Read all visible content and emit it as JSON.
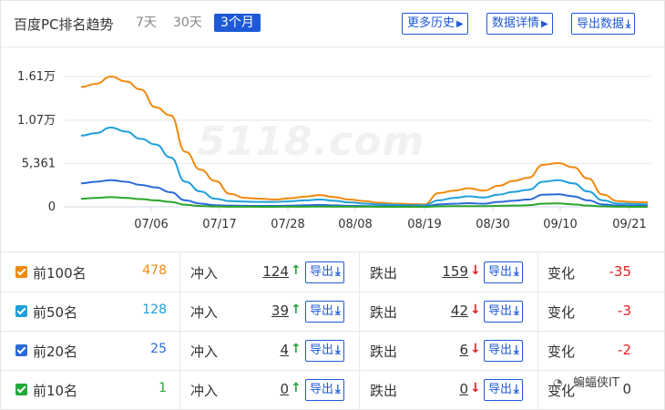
{
  "header": {
    "title": "百度PC排名趋势",
    "ranges": [
      "7天",
      "30天",
      "3个月"
    ],
    "active_range": "3个月",
    "buttons": {
      "more_history": "更多历史",
      "data_detail": "数据详情",
      "export_data": "导出数据"
    },
    "icons": {
      "more_history": "caret-right-icon",
      "data_detail": "caret-right-icon",
      "export_data": "download-icon"
    }
  },
  "watermark": "5118.com",
  "chart_data": {
    "type": "line",
    "x": [
      "07/06",
      "07/17",
      "07/28",
      "08/08",
      "08/19",
      "08/30",
      "09/10",
      "09/21"
    ],
    "y_ticks": [
      "0",
      "5,361",
      "1.07万",
      "1.61万"
    ],
    "ylim": [
      0,
      16100
    ],
    "grid": true,
    "series": [
      {
        "name": "前100名",
        "color": "#f0890c",
        "values": [
          14800,
          15200,
          16100,
          15500,
          14500,
          12300,
          11300,
          6800,
          4600,
          3200,
          1600,
          1100,
          1000,
          900,
          1050,
          1250,
          1450,
          1200,
          900,
          700,
          500,
          400,
          350,
          300,
          1700,
          2000,
          2300,
          2000,
          2600,
          3200,
          3600,
          5200,
          5400,
          4900,
          3500,
          1500,
          700,
          600,
          550
        ]
      },
      {
        "name": "前50名",
        "color": "#1ea0da",
        "values": [
          8800,
          9100,
          9800,
          9300,
          8400,
          7700,
          6100,
          3100,
          1900,
          1000,
          700,
          650,
          600,
          600,
          680,
          800,
          900,
          750,
          550,
          400,
          300,
          250,
          200,
          200,
          800,
          1100,
          1300,
          1150,
          1500,
          1850,
          2100,
          3100,
          3300,
          2900,
          1900,
          800,
          400,
          350,
          300
        ]
      },
      {
        "name": "前20名",
        "color": "#2a6ad8",
        "values": [
          2900,
          3100,
          3300,
          3100,
          2700,
          2400,
          1800,
          800,
          400,
          200,
          150,
          120,
          110,
          110,
          140,
          190,
          240,
          180,
          130,
          90,
          70,
          60,
          50,
          40,
          300,
          380,
          450,
          380,
          600,
          750,
          900,
          1500,
          1550,
          1300,
          800,
          300,
          150,
          120,
          100
        ]
      },
      {
        "name": "前10名",
        "color": "#2aa52a",
        "values": [
          1000,
          1100,
          1200,
          1100,
          950,
          800,
          600,
          250,
          100,
          40,
          20,
          10,
          5,
          5,
          10,
          20,
          30,
          20,
          15,
          10,
          5,
          5,
          0,
          0,
          60,
          80,
          90,
          80,
          120,
          150,
          200,
          400,
          420,
          300,
          150,
          50,
          10,
          5,
          0
        ]
      }
    ]
  },
  "stats_labels": {
    "rush_in": "冲入",
    "drop_out": "跌出",
    "change": "变化",
    "export": "导出"
  },
  "stats": [
    {
      "label": "前100名",
      "count": "478",
      "color": "#f0890c",
      "in": "124",
      "out": "159",
      "change": "-35",
      "change_color": "#e02020"
    },
    {
      "label": "前50名",
      "count": "128",
      "color": "#1ea0da",
      "in": "39",
      "out": "42",
      "change": "-3",
      "change_color": "#e02020"
    },
    {
      "label": "前20名",
      "count": "25",
      "color": "#2a6ad8",
      "in": "4",
      "out": "6",
      "change": "-2",
      "change_color": "#e02020"
    },
    {
      "label": "前10名",
      "count": "1",
      "color": "#22a83a",
      "in": "0",
      "out": "0",
      "change": "0",
      "change_color": "#333333"
    }
  ],
  "footer": {
    "wechat_label": "蝙蝠侠IT",
    "icon": "wechat-icon"
  }
}
